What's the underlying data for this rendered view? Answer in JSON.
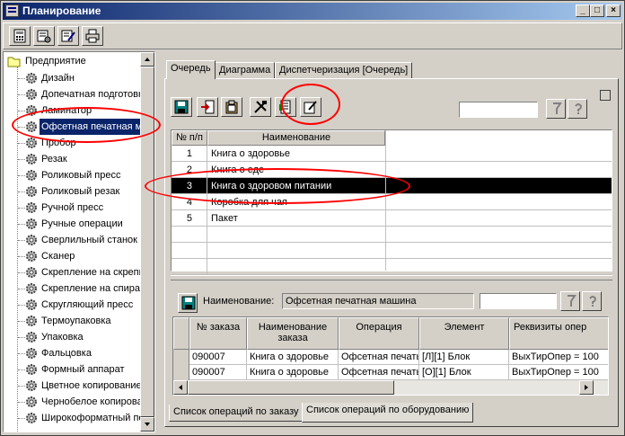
{
  "window": {
    "title": "Планирование"
  },
  "toolbar": {
    "buttons": [
      "calculator-icon",
      "db-settings-icon",
      "edit-list-icon",
      "print-icon"
    ]
  },
  "tree": {
    "root": "Предприятие",
    "items": [
      "Дизайн",
      "Допечатная подготовка",
      "Ламинатор",
      "Офсетная печатная машина",
      "Пробор",
      "Резак",
      "Роликовый пресс",
      "Роликовый резак",
      "Ручной пресс",
      "Ручные операции",
      "Сверлильный станок",
      "Сканер",
      "Скрепление на скрепку",
      "Скрепление на спираль",
      "Скругляющий пресс",
      "Термоупаковка",
      "Упаковка",
      "Фальцовка",
      "Формный аппарат",
      "Цветное копирование",
      "Чернобелое копирование",
      "Широкоформатный печать"
    ],
    "selected_index": 3
  },
  "tabs": [
    "Очередь",
    "Диаграмма",
    "Диспетчеризация [Очередь]"
  ],
  "queue": {
    "columns": [
      "№ п/п",
      "Наименование"
    ],
    "rows": [
      {
        "num": "1",
        "name": "Книга о здоровье"
      },
      {
        "num": "2",
        "name": "Книга о еде"
      },
      {
        "num": "3",
        "name": "Книга о здоровом питании"
      },
      {
        "num": "4",
        "name": "Коробка для чая"
      },
      {
        "num": "5",
        "name": "Пакет"
      }
    ],
    "selected_row": 2,
    "search_value": ""
  },
  "equipment": {
    "label": "Наименование:",
    "value": "Офсетная печатная машина",
    "filter_value": ""
  },
  "ops": {
    "columns": [
      "№ заказа",
      "Наименование заказа",
      "Операция",
      "Элемент",
      "Реквизиты опер"
    ],
    "rows": [
      {
        "order": "090007",
        "name": "Книга о здоровье",
        "operation": "Офсетная печать",
        "element": "[Л][1] Блок",
        "props": "ВыхТирОпер = 100"
      },
      {
        "order": "090007",
        "name": "Книга о здоровье",
        "operation": "Офсетная печать",
        "element": "[О][1] Блок",
        "props": "ВыхТирОпер = 100"
      }
    ]
  },
  "bottom_tabs": [
    "Список операций по заказу",
    "Список операций по оборудованию"
  ],
  "colors": {
    "selection": "#0a246a",
    "window": "#d4d0c8",
    "annotation": "#ff0000"
  }
}
